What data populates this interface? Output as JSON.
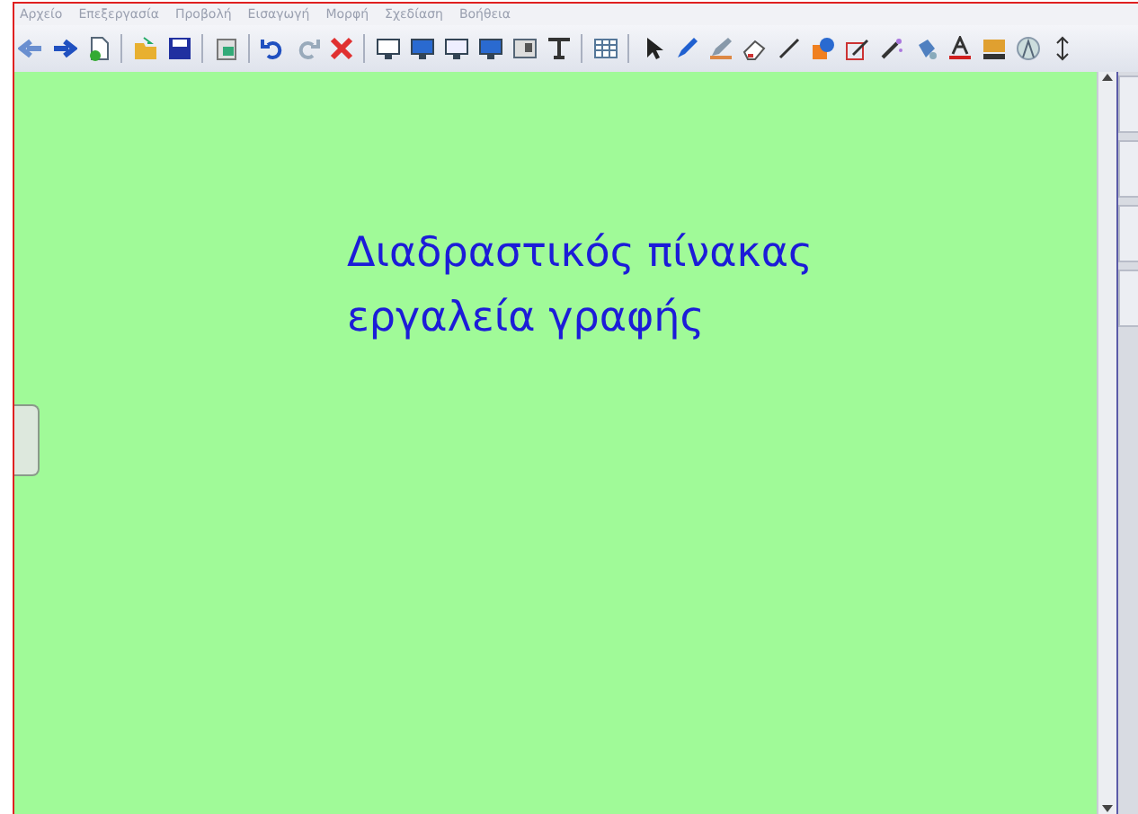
{
  "menu": [
    {
      "label": "Αρχείο"
    },
    {
      "label": "Επεξεργασία"
    },
    {
      "label": "Προβολή"
    },
    {
      "label": "Εισαγωγή"
    },
    {
      "label": "Μορφή"
    },
    {
      "label": "Σχεδίαση"
    },
    {
      "label": "Βοήθεια"
    }
  ],
  "canvas": {
    "lines": [
      "Διαδραστικός πίνακας",
      "εργαλεία γραφής"
    ]
  }
}
